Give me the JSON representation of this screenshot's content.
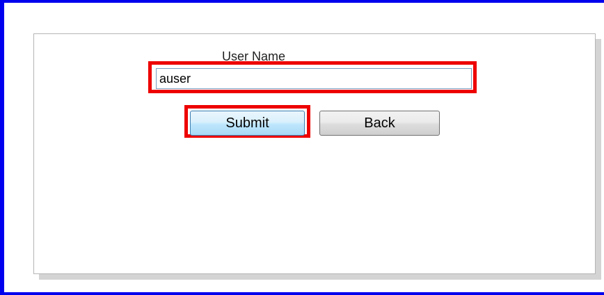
{
  "form": {
    "username_label": "User Name",
    "username_value": "auser",
    "submit_label": "Submit",
    "back_label": "Back"
  },
  "colors": {
    "window_border": "#0000ee",
    "highlight": "#ee0000",
    "submit_button_face": "#bee6fd",
    "back_button_face": "#dddddd"
  }
}
